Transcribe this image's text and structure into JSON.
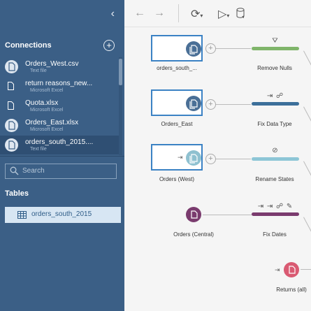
{
  "sidebar": {
    "collapse_icon": "chevron-left-icon",
    "connections_title": "Connections",
    "add_icon": "plus-icon",
    "connections": [
      {
        "name": "Orders_West.csv",
        "type": "Text file",
        "icon": "csv-file-icon"
      },
      {
        "name": "return reasons_new...",
        "type": "Microsoft Excel",
        "icon": "excel-file-icon"
      },
      {
        "name": "Quota.xlsx",
        "type": "Microsoft Excel",
        "icon": "excel-file-icon"
      },
      {
        "name": "Orders_East.xlsx",
        "type": "Microsoft Excel",
        "icon": "excel-file-icon"
      },
      {
        "name": "orders_south_2015....",
        "type": "Text file",
        "icon": "csv-file-icon"
      }
    ],
    "search_placeholder": "Search",
    "tables_title": "Tables",
    "tables": [
      {
        "name": "orders_south_2015",
        "icon": "table-icon"
      }
    ]
  },
  "toolbar": {
    "back_icon": "arrow-left-icon",
    "forward_icon": "arrow-right-icon",
    "refresh_icon": "refresh-icon",
    "run_icon": "run-flow-icon"
  },
  "flow": {
    "inputs": [
      {
        "label": "orders_south_...",
        "color": "#4a6f96"
      },
      {
        "label": "Orders_East",
        "color": "#4a6f96"
      },
      {
        "label": "Orders (West)",
        "color": "#8fc1d0"
      },
      {
        "label": "Orders (Central)",
        "color": "#7a3b6e"
      },
      {
        "label": "Returns (all)",
        "color": "#d95a72"
      }
    ],
    "steps": [
      {
        "label": "Remove Nulls",
        "color": "#7fb56a",
        "icons": "⛛"
      },
      {
        "label": "Fix Data Type",
        "color": "#3c6f9a",
        "icons": "⇥ ☍"
      },
      {
        "label": "Rename States",
        "color": "#8dc6d6",
        "icons": "⊘"
      },
      {
        "label": "Fix Dates",
        "color": "#7a3b6e",
        "icons": "⇥ ⇥ ☍ ✎"
      }
    ]
  }
}
